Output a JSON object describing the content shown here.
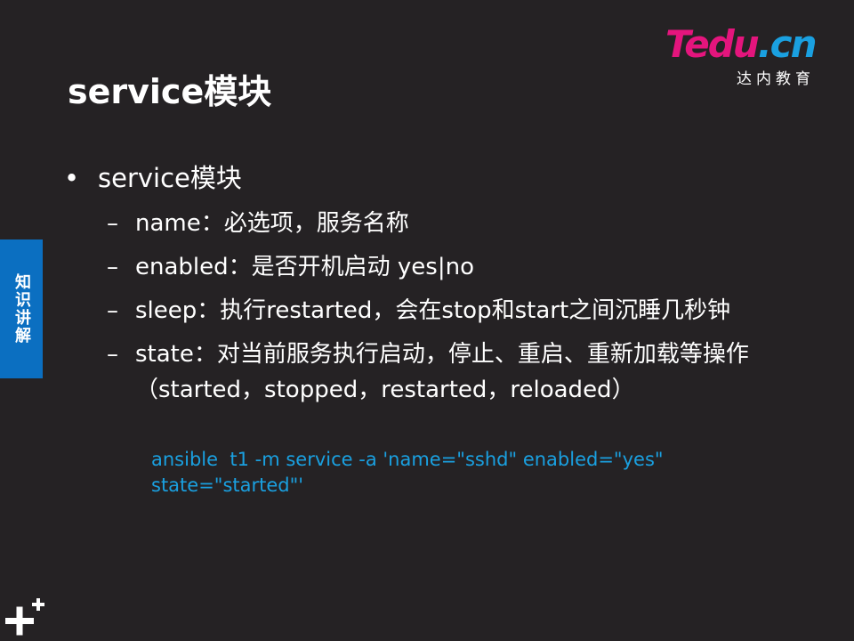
{
  "slide": {
    "title": "service模块",
    "logo": {
      "brand_t": "T",
      "brand_rest": "edu",
      "brand_dot": ".",
      "brand_cn": "cn",
      "subtitle": "达内教育"
    },
    "side_tab": "知识讲解",
    "bullets": {
      "main": "service模块",
      "items": [
        "name：必选项，服务名称",
        "enabled：是否开机启动 yes|no",
        "sleep：执行restarted，会在stop和start之间沉睡几秒钟",
        "state：对当前服务执行启动，停止、重启、重新加载等操作（started，stopped，restarted，reloaded）"
      ]
    },
    "code_example": "ansible  t1 -m service -a 'name=\"sshd\" enabled=\"yes\" state=\"started\"'",
    "bullet_marks": {
      "l1": "•",
      "l2": "–"
    }
  },
  "colors": {
    "background": "#252224",
    "accent_blue": "#1aa0e0",
    "brand_pink": "#e4157d",
    "side_tab": "#0b6fc1"
  }
}
